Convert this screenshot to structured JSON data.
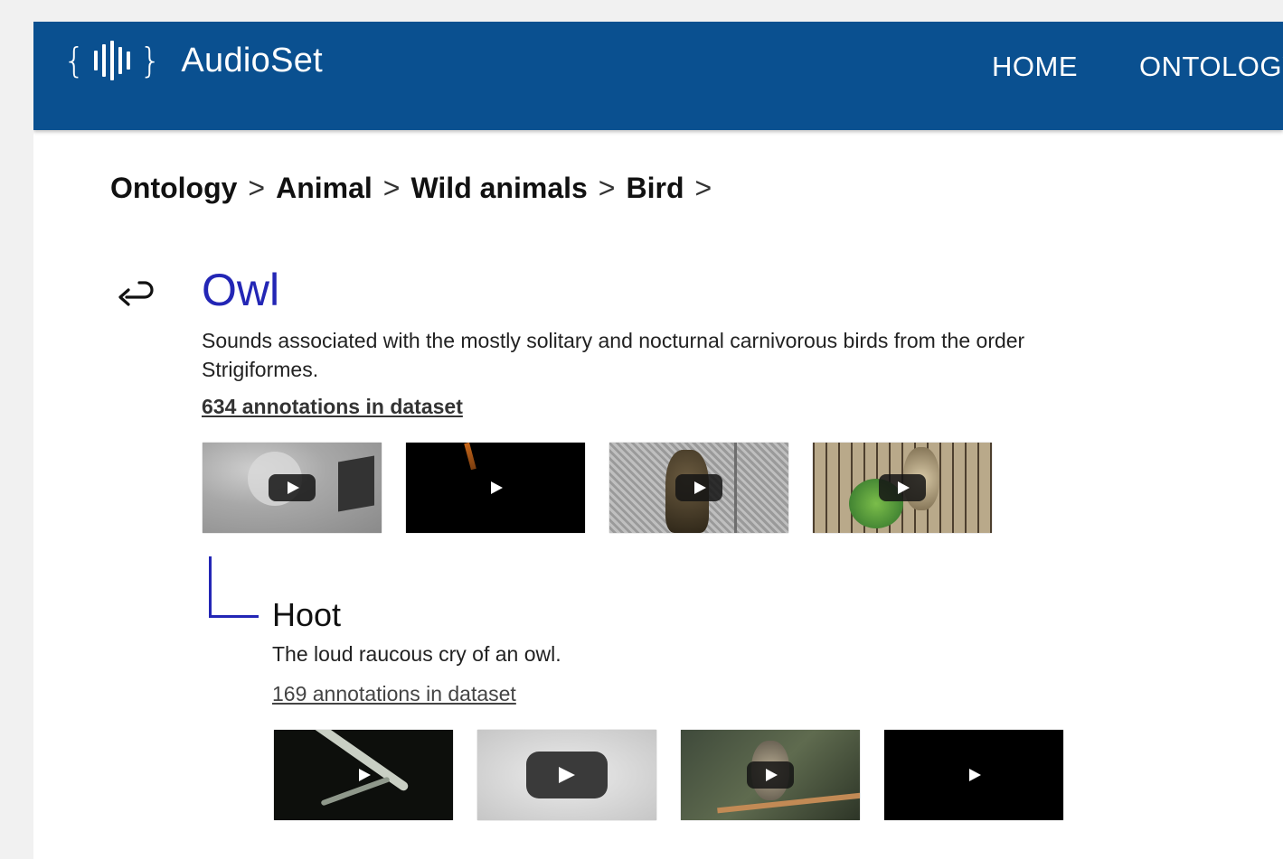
{
  "header": {
    "logo_open_brace": "{",
    "logo_close_brace": "}",
    "logo_text": "AudioSet",
    "nav": {
      "home": "HOME",
      "ontology": "ONTOLOGY"
    }
  },
  "breadcrumb": {
    "items": [
      "Ontology",
      "Animal",
      "Wild animals",
      "Bird"
    ],
    "separator": ">"
  },
  "back_icon": "return-arrow-icon",
  "category": {
    "title": "Owl",
    "description": "Sounds associated with the mostly solitary and nocturnal carnivorous birds from the order Strigiformes.",
    "annotations_link": "634 annotations in dataset",
    "video_count": 4
  },
  "subcategory": {
    "title": "Hoot",
    "description": "The loud raucous cry of an owl.",
    "annotations_link": "169 annotations in dataset",
    "video_count": 4
  },
  "colors": {
    "header_bg": "#0a5090",
    "title_blue": "#2326b5",
    "page_bg": "#ffffff",
    "outer_bg": "#f1f1f1"
  }
}
